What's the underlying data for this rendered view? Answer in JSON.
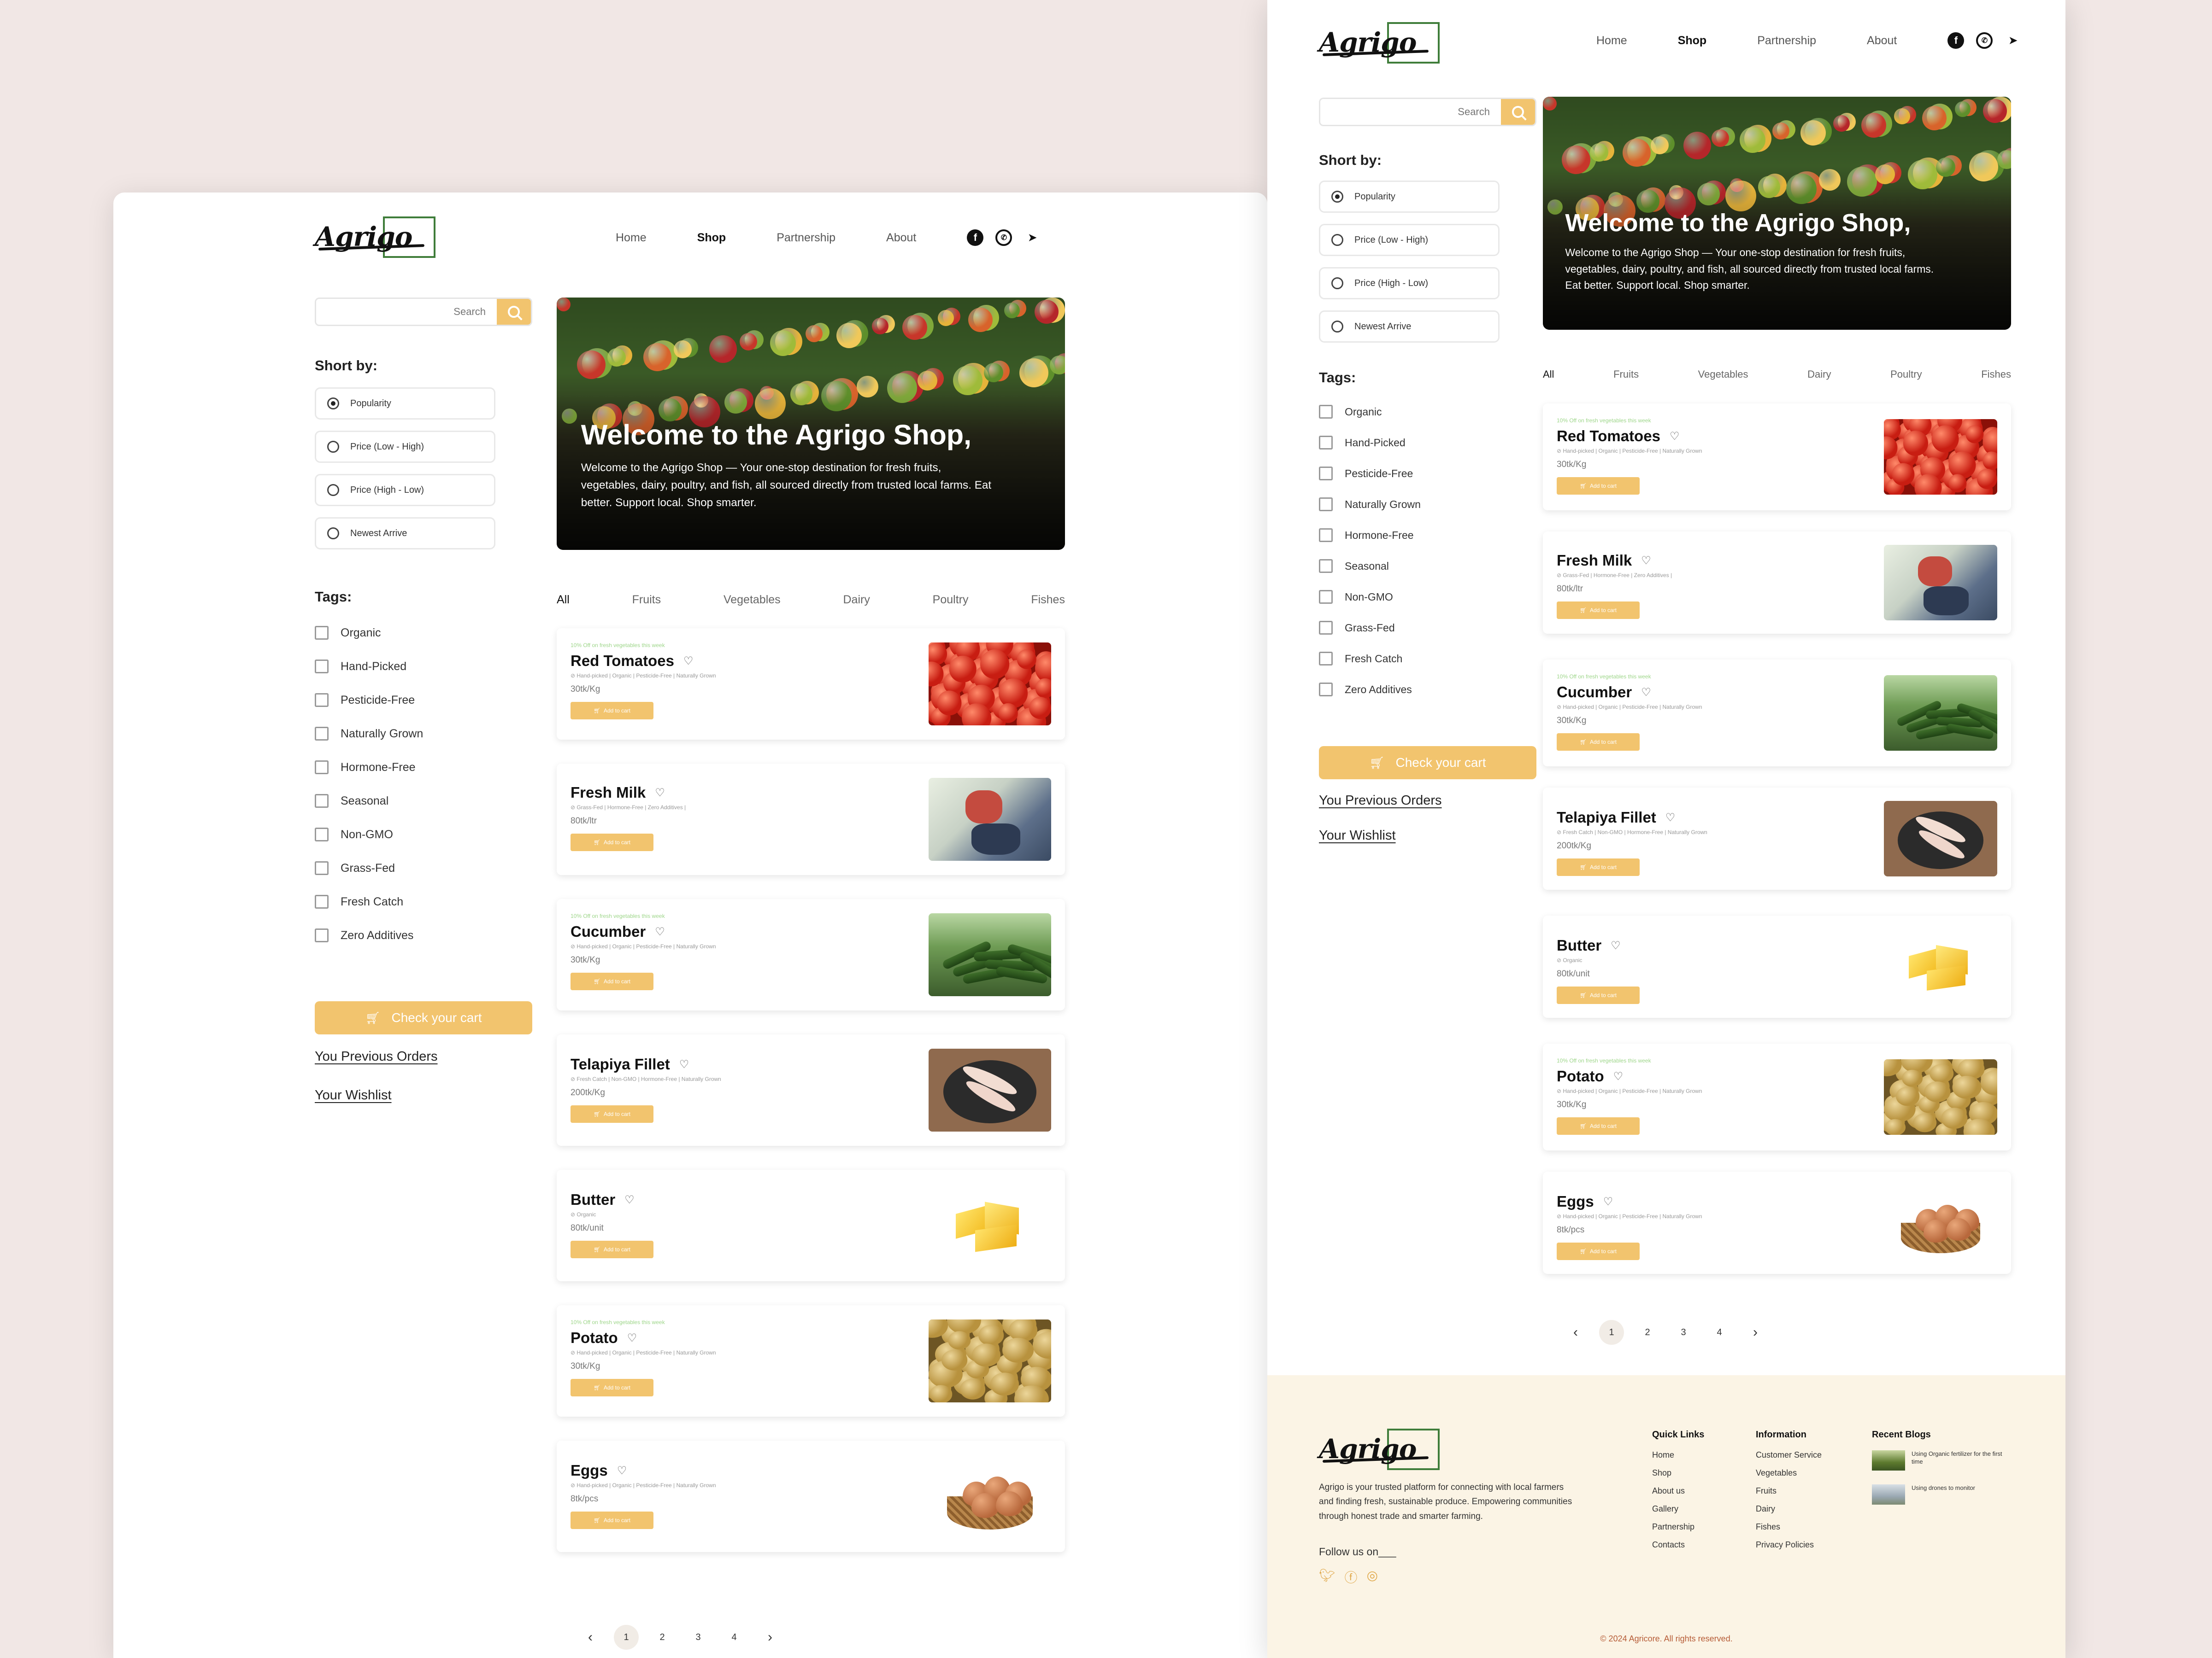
{
  "brand": {
    "logo": "Agrigo"
  },
  "nav": {
    "items": [
      "Home",
      "Shop",
      "Partnership",
      "About"
    ],
    "active": "Shop",
    "social": [
      "facebook-icon",
      "whatsapp-icon",
      "telegram-icon"
    ]
  },
  "search": {
    "placeholder": "Search"
  },
  "sort": {
    "heading": "Short by:",
    "options": [
      "Popularity",
      "Price (Low - High)",
      "Price (High - Low)",
      "Newest Arrive"
    ],
    "selected": "Popularity"
  },
  "tags": {
    "heading": "Tags:",
    "items": [
      "Organic",
      "Hand-Picked",
      "Pesticide-Free",
      "Naturally Grown",
      "Hormone-Free",
      "Seasonal",
      "Non-GMO",
      "Grass-Fed",
      "Fresh Catch",
      "Zero Additives"
    ]
  },
  "sidebar_links": {
    "cart": "Check your cart",
    "orders": "You Previous Orders",
    "wishlist": "Your Wishlist"
  },
  "hero": {
    "title": "Welcome to the Agrigo  Shop,",
    "subtitle": "Welcome to the Agrigo Shop — Your one-stop destination for fresh fruits, vegetables, dairy, poultry, and fish, all sourced directly from trusted local farms. Eat better. Support local. Shop smarter."
  },
  "categories": {
    "items": [
      "All",
      "Fruits",
      "Vegetables",
      "Dairy",
      "Poultry",
      "Fishes"
    ],
    "active": "All"
  },
  "products": [
    {
      "promo": "10% Off on fresh vegetables this week",
      "name": "Red Tomatoes",
      "tags": "Hand-picked | Organic | Pesticide-Free | Naturally Grown",
      "price": "30tk/Kg",
      "add": "Add to cart"
    },
    {
      "promo": "",
      "name": "Fresh Milk",
      "tags": "Grass-Fed | Hormone-Free | Zero Additives |",
      "price": "80tk/ltr",
      "add": "Add to cart"
    },
    {
      "promo": "10% Off on fresh vegetables this week",
      "name": "Cucumber",
      "tags": "Hand-picked | Organic | Pesticide-Free | Naturally Grown",
      "price": "30tk/Kg",
      "add": "Add to cart"
    },
    {
      "promo": "",
      "name": "Telapiya Fillet",
      "tags": "Fresh Catch | Non-GMO | Hormone-Free | Naturally Grown",
      "price": "200tk/Kg",
      "add": "Add to cart"
    },
    {
      "promo": "",
      "name": "Butter",
      "tags": "Organic",
      "price": "80tk/unit",
      "add": "Add to cart"
    },
    {
      "promo": "10% Off on fresh vegetables this week",
      "name": "Potato",
      "tags": "Hand-picked | Organic | Pesticide-Free | Naturally Grown",
      "price": "30tk/Kg",
      "add": "Add to cart"
    },
    {
      "promo": "",
      "name": "Eggs",
      "tags": "Hand-picked | Organic | Pesticide-Free | Naturally Grown",
      "price": "8tk/pcs",
      "add": "Add to cart"
    }
  ],
  "pagination": {
    "pages": [
      "1",
      "2",
      "3",
      "4"
    ],
    "current": "1",
    "prev": "‹",
    "next": "›"
  },
  "footer": {
    "about": "Agrigo is your trusted platform for connecting with local farmers and finding fresh, sustainable produce. Empowering communities through honest trade and smarter farming.",
    "follow": "Follow us on___",
    "quick_links": {
      "heading": "Quick Links",
      "items": [
        "Home",
        "Shop",
        "About us",
        "Gallery",
        "Partnership",
        "Contacts"
      ]
    },
    "information": {
      "heading": "Information",
      "items": [
        "Customer Service",
        "Vegetables",
        "Fruits",
        "Dairy",
        "Fishes",
        "Privacy Policies"
      ]
    },
    "recent_blogs": {
      "heading": "Recent Blogs",
      "items": [
        "Using Organic fertilizer for the first time",
        "Using drones to monitor"
      ]
    },
    "copyright": "© 2024 Agricore. All rights reserved."
  },
  "colors": {
    "accent": "#f2c46e",
    "logo_box": "#3f7d3a",
    "promo": "#9ed68a",
    "background": "#f1e7e5",
    "footer_bg": "#fbf4e5"
  }
}
